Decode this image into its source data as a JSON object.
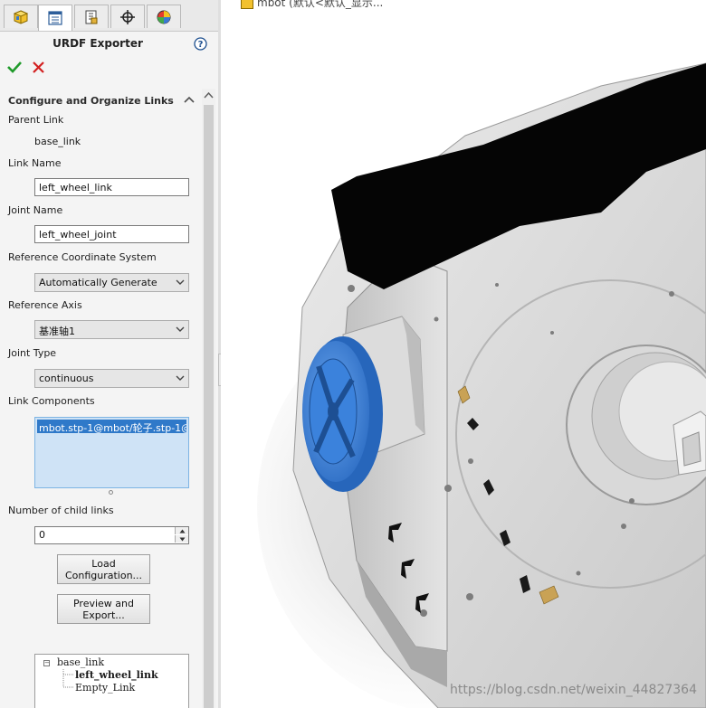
{
  "panel": {
    "tabs": [
      {
        "icon": "feature-manager-icon"
      },
      {
        "icon": "property-manager-icon"
      },
      {
        "icon": "configuration-manager-icon"
      },
      {
        "icon": "dimxpert-icon"
      },
      {
        "icon": "display-manager-icon"
      }
    ],
    "title": "URDF Exporter",
    "group_header": "Configure and Organize Links",
    "parent_link_label": "Parent Link",
    "parent_link_value": "base_link",
    "link_name_label": "Link Name",
    "link_name_value": "left_wheel_link",
    "joint_name_label": "Joint Name",
    "joint_name_value": "left_wheel_joint",
    "ref_coord_label": "Reference Coordinate System",
    "ref_coord_value": "Automatically Generate",
    "ref_axis_label": "Reference Axis",
    "ref_axis_value": "基准轴1",
    "joint_type_label": "Joint Type",
    "joint_type_value": "continuous",
    "link_components_label": "Link Components",
    "link_components_items": [
      "mbot.stp-1@mbot/轮子.stp-1@"
    ],
    "child_links_label": "Number of child links",
    "child_links_value": "0",
    "load_button": [
      "Load",
      "Configuration..."
    ],
    "preview_button": [
      "Preview and",
      "Export..."
    ],
    "tree": {
      "root": "base_link",
      "children": [
        "left_wheel_link",
        "Empty_Link"
      ]
    }
  },
  "viewport": {
    "breadcrumb": "mbot  (默认<默认_显示...",
    "watermark": "https://blog.csdn.net/weixin_44827364",
    "model_color": "#d8d8d8",
    "selected_color": "#3f86e0"
  }
}
